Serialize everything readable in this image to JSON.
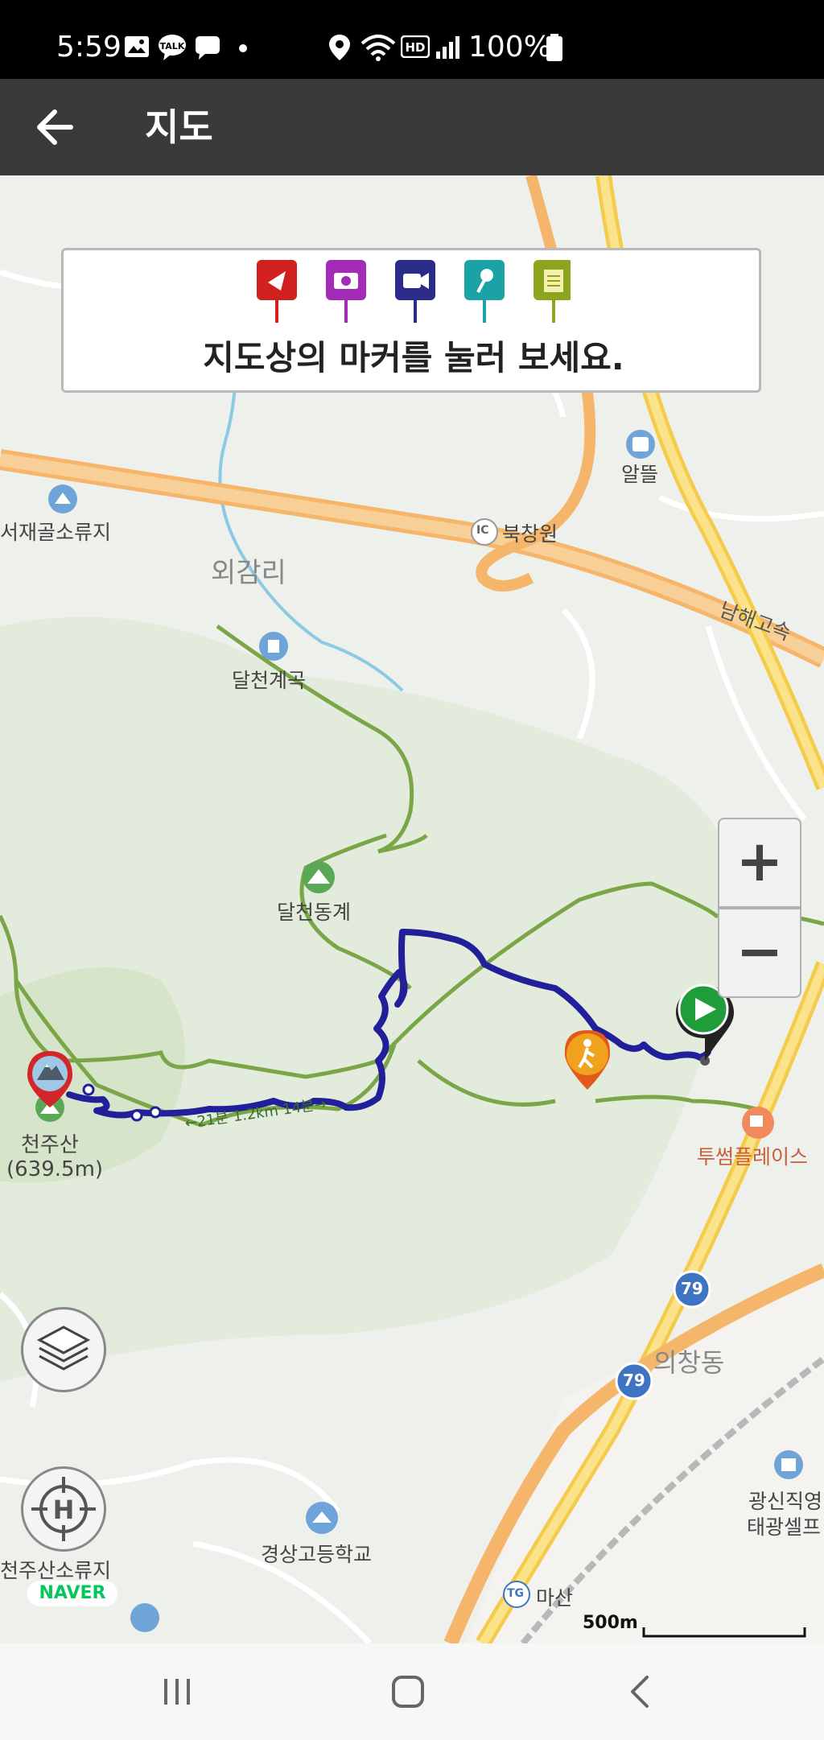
{
  "status_bar": {
    "time": "5:59",
    "battery": "100%",
    "icons": [
      "gallery-icon",
      "talk-icon",
      "message-icon",
      "dot-icon",
      "location-icon",
      "wifi-icon",
      "hd-icon",
      "signal-icon",
      "battery-icon"
    ]
  },
  "app_bar": {
    "title": "지도",
    "back_icon": "arrow-left-icon"
  },
  "legend": {
    "caption": "지도상의 마커를 눌러 보세요.",
    "markers": [
      {
        "name": "flag-marker",
        "color": "#d0201f"
      },
      {
        "name": "camera-marker",
        "color": "#a32bb8"
      },
      {
        "name": "video-marker",
        "color": "#2b2b8a"
      },
      {
        "name": "voice-marker",
        "color": "#1aa2a6"
      },
      {
        "name": "memo-marker",
        "color": "#8ea41c"
      }
    ]
  },
  "map": {
    "labels": {
      "aldde": "알뜰",
      "bukchangwon": "북창원",
      "ic": "IC",
      "seojaegol": "서재골소류지",
      "oegamri": "외감리",
      "namhae": "남해고속",
      "dalcheon_valley": "달천계곡",
      "dalcheon_donggye": "달천동계",
      "cheonjusan": "천주산",
      "cheonjusan_height": "(639.5m)",
      "tosome": "투썸플레이스",
      "route_79a": "79",
      "route_79b": "79",
      "uichang": "의창동",
      "gwangsin_1": "광신직영",
      "gwangsin_2": "태광셀프",
      "gyeongsang": "경상고등학교",
      "cheonjusan_reservoir": "천주산소류지",
      "tg": "TG",
      "masan": "마산",
      "trail_note": "←21분 1.2km 14분→"
    },
    "scale": "500m",
    "provider": "NAVER",
    "colors": {
      "track": "#21209a",
      "highway": "#f5b66b",
      "trail": "#7aa648",
      "water": "#8ec9e3",
      "start_marker": "#1e9d3a",
      "summit_marker": "#d3262b",
      "hiker_marker": "#f08b1d"
    }
  },
  "controls": {
    "zoom_in": "+",
    "zoom_out": "−",
    "layers_icon": "layers-icon",
    "home_icon": "home-location-icon"
  },
  "nav_bar": {
    "recent_icon": "recent-apps-icon",
    "home_icon": "home-icon",
    "back_icon": "back-icon"
  }
}
